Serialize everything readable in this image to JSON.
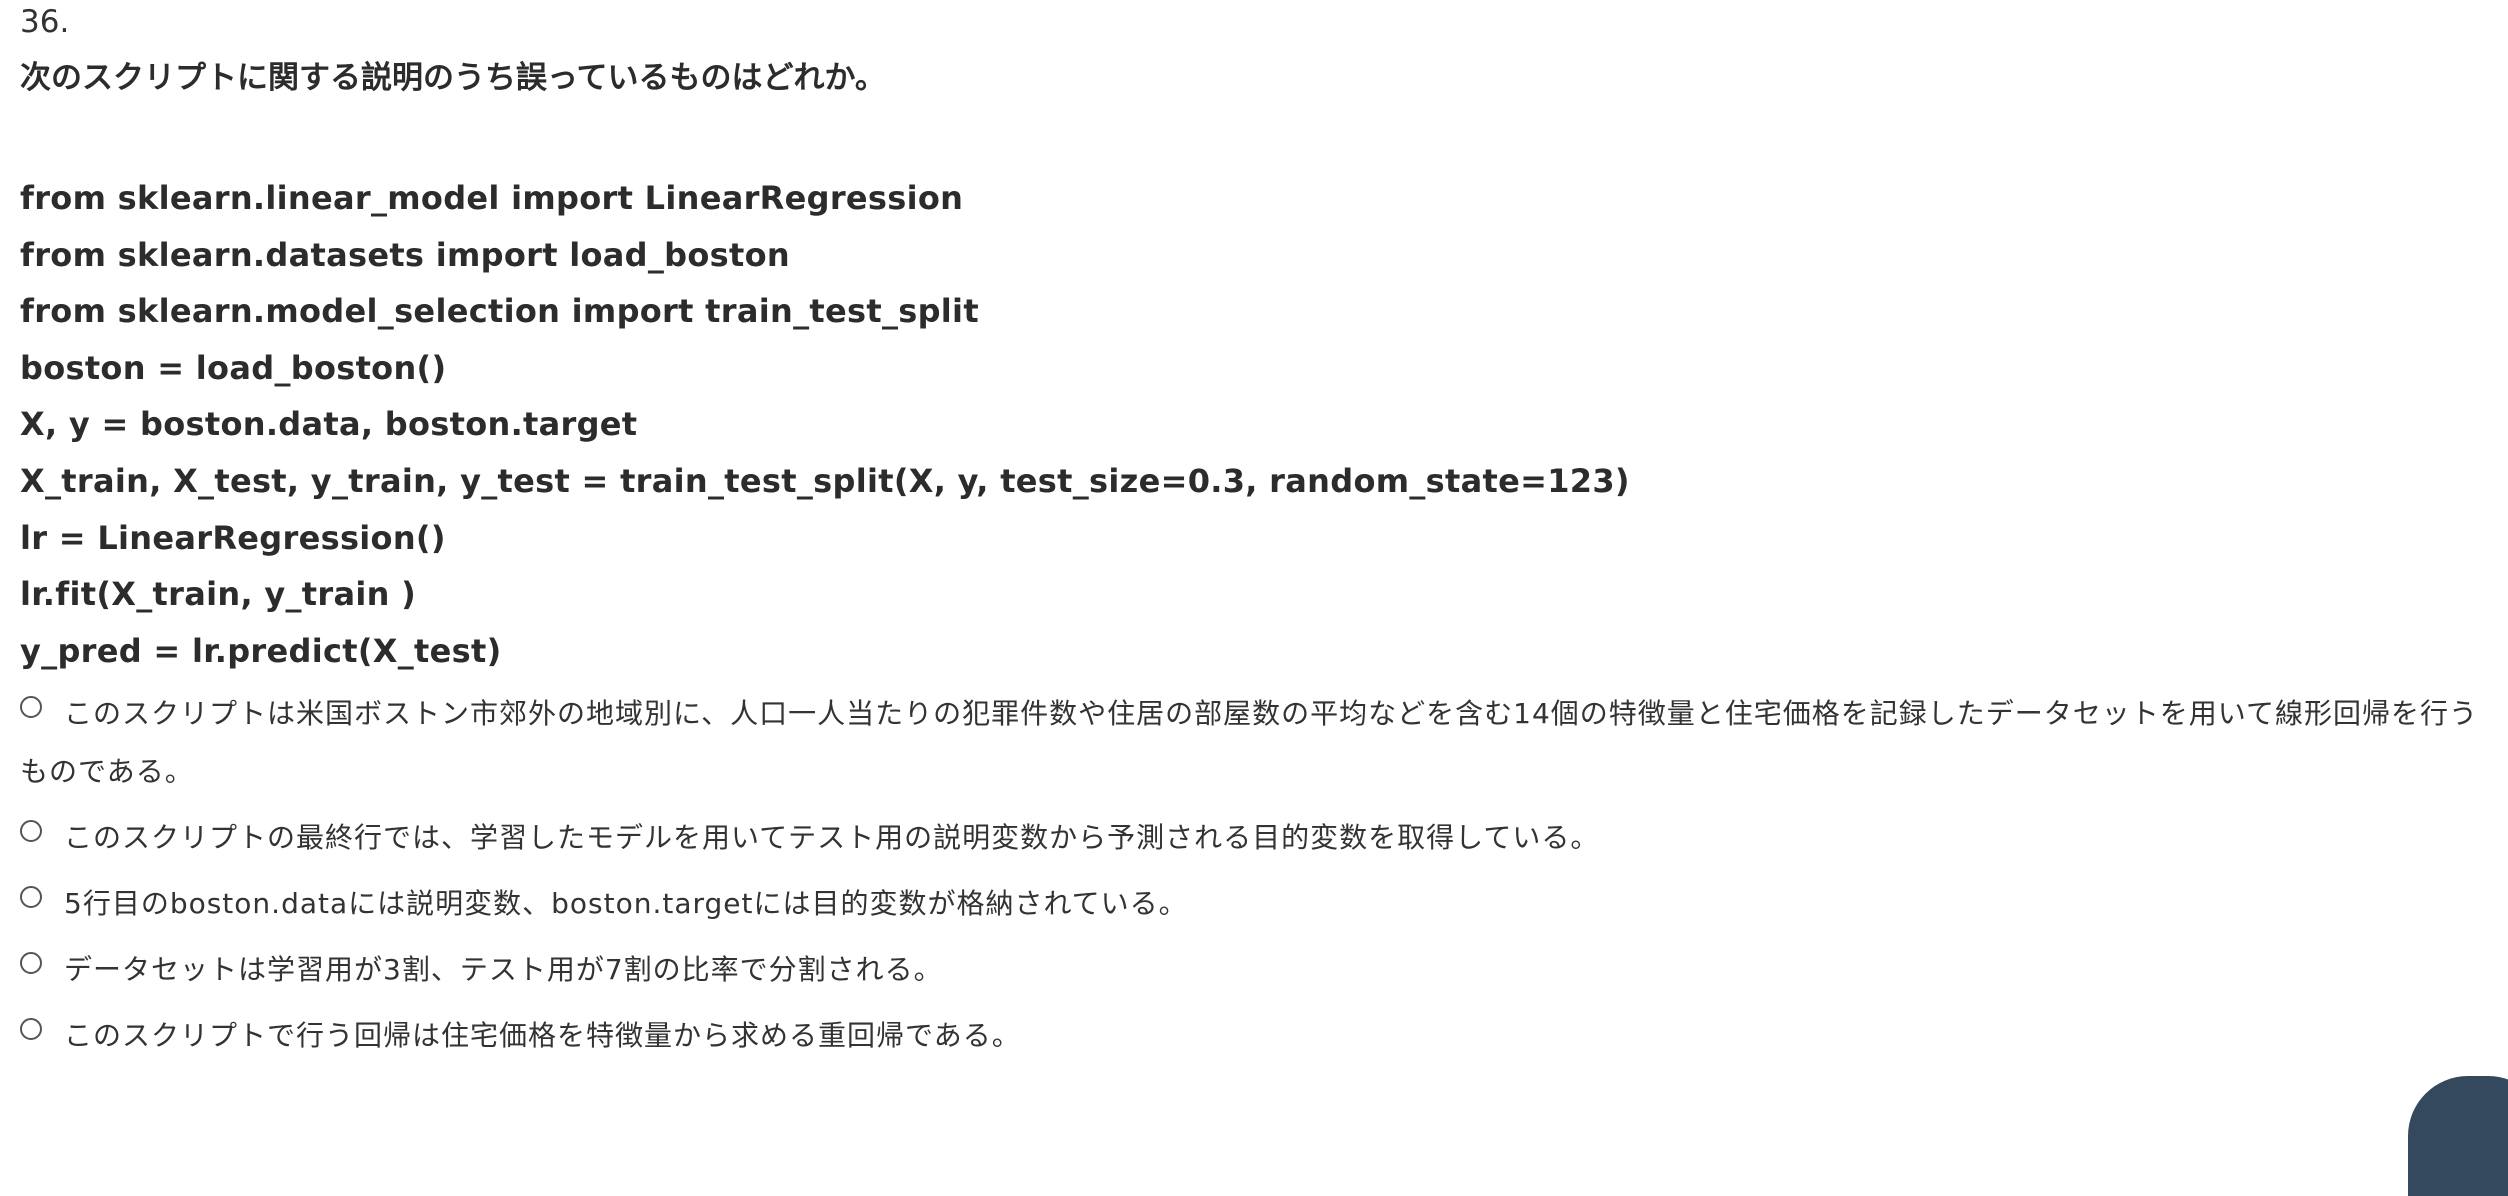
{
  "question": {
    "number": "36.",
    "text": "次のスクリプトに関する説明のうち誤っているものはどれか。"
  },
  "code_lines": [
    "from sklearn.linear_model import LinearRegression",
    "from sklearn.datasets import load_boston",
    "from sklearn.model_selection import train_test_split",
    "boston = load_boston()",
    "X, y = boston.data, boston.target",
    "X_train, X_test, y_train, y_test = train_test_split(X, y, test_size=0.3, random_state=123)",
    "lr = LinearRegression()",
    "lr.fit(X_train, y_train )",
    "y_pred = lr.predict(X_test)"
  ],
  "choices": [
    "このスクリプトは米国ボストン市郊外の地域別に、人口一人当たりの犯罪件数や住居の部屋数の平均などを含む14個の特徴量と住宅価格を記録したデータセットを用いて線形回帰を行うものである。",
    "このスクリプトの最終行では、学習したモデルを用いてテスト用の説明変数から予測される目的変数を取得している。",
    "5行目のboston.dataには説明変数、boston.targetには目的変数が格納されている。",
    "データセットは学習用が3割、テスト用が7割の比率で分割される。",
    "このスクリプトで行う回帰は住宅価格を特徴量から求める重回帰である。"
  ]
}
